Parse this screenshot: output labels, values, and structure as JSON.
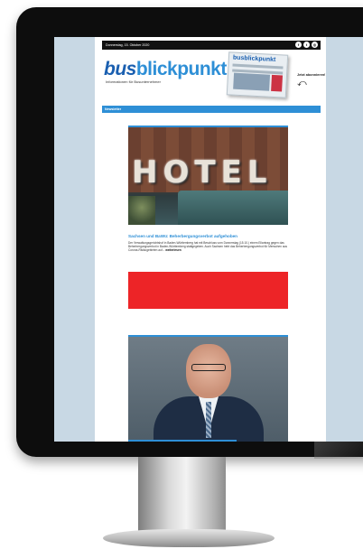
{
  "newsletter": {
    "date_line": "Donnerstag, 15. Oktober 2020",
    "social_icons": [
      "facebook-icon",
      "twitter-icon",
      "instagram-icon"
    ],
    "logo_bus": "bus",
    "logo_rest": "blickpunkt",
    "tagline": "Informationen für Busunternehmer",
    "magazine_title": "busblickpunkt",
    "jetzt_text": "Jetzt abonnieren!",
    "nav_label": "Newsletter",
    "article1": {
      "image_text": "HOTEL",
      "title": "Sachsen und BaWü: Beherbergungsverbot aufgehoben",
      "body": "Der Verwaltungsgerichtshof in Baden-Württemberg hat mit Beschluss vom Donnerstag (15.10.) einem Eilantrag gegen das Beherbergungsverbot in Baden-Württemberg stattgegeben. Auch Sachsen hebt das Beherbergungsverbot für Menschen aus Corona-Risikogebieten auf...",
      "more": "weiterlesen"
    }
  },
  "colors": {
    "brand_blue": "#2e8fd6",
    "logo_blue": "#1a5fb0",
    "banner_red": "#ed2427"
  }
}
